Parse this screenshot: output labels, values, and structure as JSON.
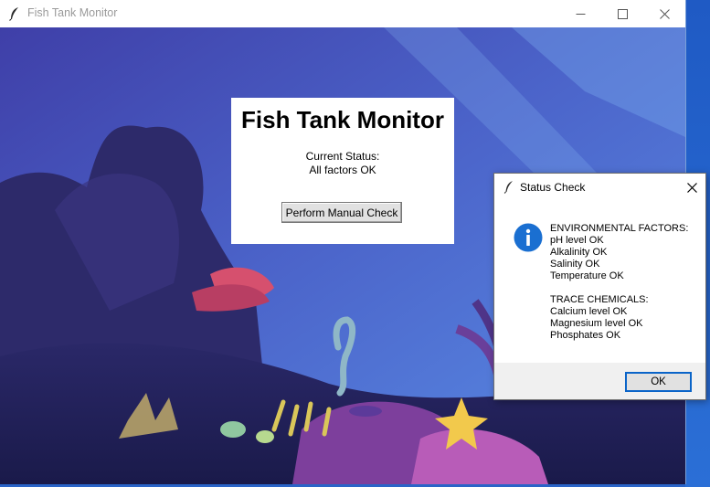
{
  "window": {
    "title": "Fish Tank Monitor",
    "controls": [
      "minimize-icon",
      "maximize-icon",
      "close-icon"
    ]
  },
  "panel": {
    "heading": "Fish Tank Monitor",
    "status_label": "Current Status:",
    "status_value": "All factors OK",
    "check_button": "Perform Manual Check"
  },
  "dialog": {
    "title": "Status Check",
    "icon": "info-icon",
    "environmental_heading": "ENVIRONMENTAL FACTORS:",
    "environmental_items": [
      "pH level OK",
      "Alkalinity OK",
      "Salinity OK",
      "Temperature OK"
    ],
    "trace_heading": "TRACE CHEMICALS:",
    "trace_items": [
      "Calcium level OK",
      "Magnesium level OK",
      "Phosphates OK"
    ],
    "ok_button": "OK"
  },
  "colors": {
    "accent": "#0a64c8",
    "info_icon": "#1a6fd1",
    "desktop": "#2a64c8"
  }
}
